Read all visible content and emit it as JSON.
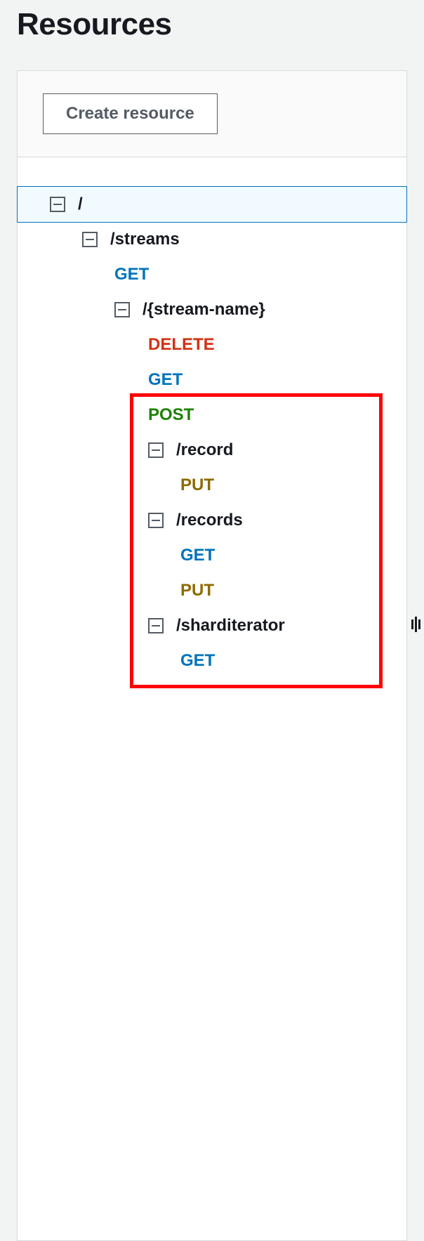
{
  "header": {
    "title": "Resources",
    "create_button": "Create resource"
  },
  "tree": {
    "root": "/",
    "streams": {
      "label": "/streams",
      "methods": {
        "get": "GET"
      },
      "stream_name": {
        "label": "/{stream-name}",
        "methods": {
          "delete": "DELETE",
          "get": "GET",
          "post": "POST"
        },
        "record": {
          "label": "/record",
          "methods": {
            "put": "PUT"
          }
        },
        "records": {
          "label": "/records",
          "methods": {
            "get": "GET",
            "put": "PUT"
          }
        },
        "sharditerator": {
          "label": "/sharditerator",
          "methods": {
            "get": "GET"
          }
        }
      }
    }
  }
}
